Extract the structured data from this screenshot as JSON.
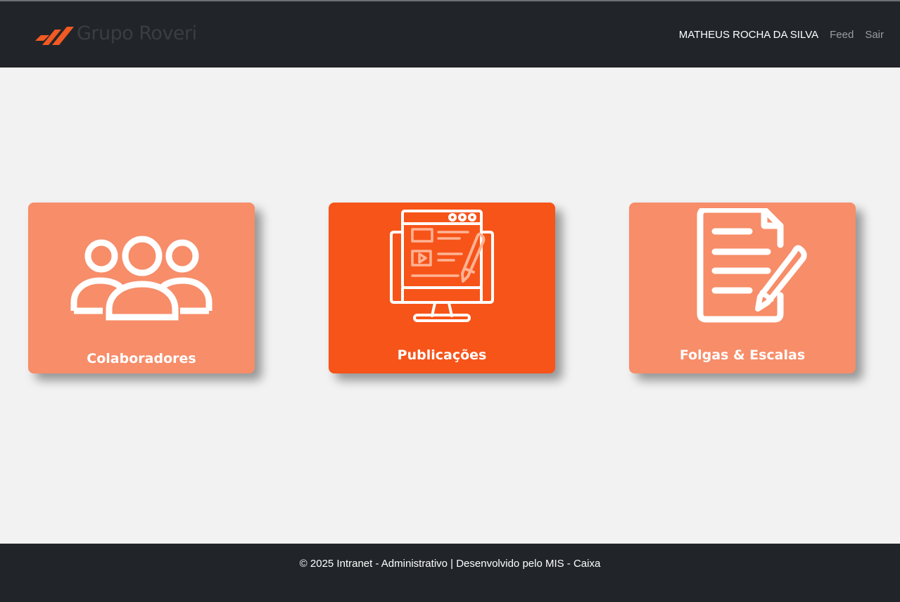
{
  "navbar": {
    "brand": {
      "name": "Grupo Roveri",
      "icon": "brand-slashes-logo",
      "accent": "#f15a22"
    },
    "user_name": "MATHEUS ROCHA DA SILVA",
    "links": {
      "feed": "Feed",
      "logout": "Sair"
    }
  },
  "cards": [
    {
      "title": "Colaboradores",
      "icon": "people-group-icon",
      "color": "#f78d69"
    },
    {
      "title": "Publicações",
      "icon": "monitor-publication-icon",
      "color": "#f75419"
    },
    {
      "title": "Folgas & Escalas",
      "icon": "document-pencil-icon",
      "color": "#f78d69"
    }
  ],
  "footer": {
    "text": "© 2025 Intranet - Administrativo | Desenvolvido pelo MIS - Caixa"
  }
}
